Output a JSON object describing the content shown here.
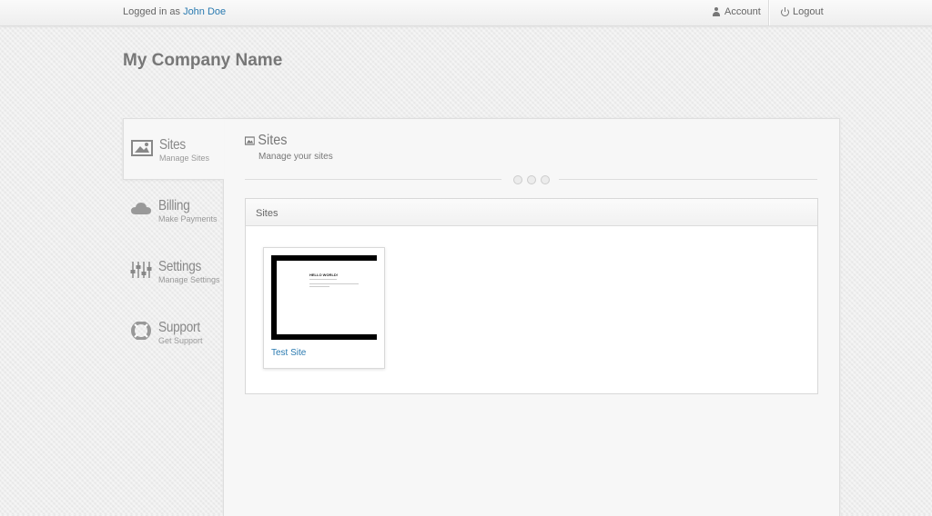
{
  "topbar": {
    "logged_prefix": "Logged in as ",
    "user_name": "John Doe",
    "account_label": "Account",
    "logout_label": "Logout"
  },
  "company_name": "My Company Name",
  "sidebar": {
    "items": [
      {
        "title": "Sites",
        "subtitle": "Manage Sites",
        "icon": "image-icon",
        "active": true
      },
      {
        "title": "Billing",
        "subtitle": "Make Payments",
        "icon": "cloud-icon",
        "active": false
      },
      {
        "title": "Settings",
        "subtitle": "Manage Settings",
        "icon": "sliders-icon",
        "active": false
      },
      {
        "title": "Support",
        "subtitle": "Get Support",
        "icon": "lifebuoy-icon",
        "active": false
      }
    ]
  },
  "content": {
    "title": "Sites",
    "subtitle": "Manage your sites",
    "box_title": "Sites",
    "sites": [
      {
        "name": "Test Site",
        "preview_heading": "HELLO WORLD!"
      }
    ]
  },
  "colors": {
    "link": "#2a7ab0",
    "background": "#efefef",
    "panel": "#f7f7f7"
  }
}
